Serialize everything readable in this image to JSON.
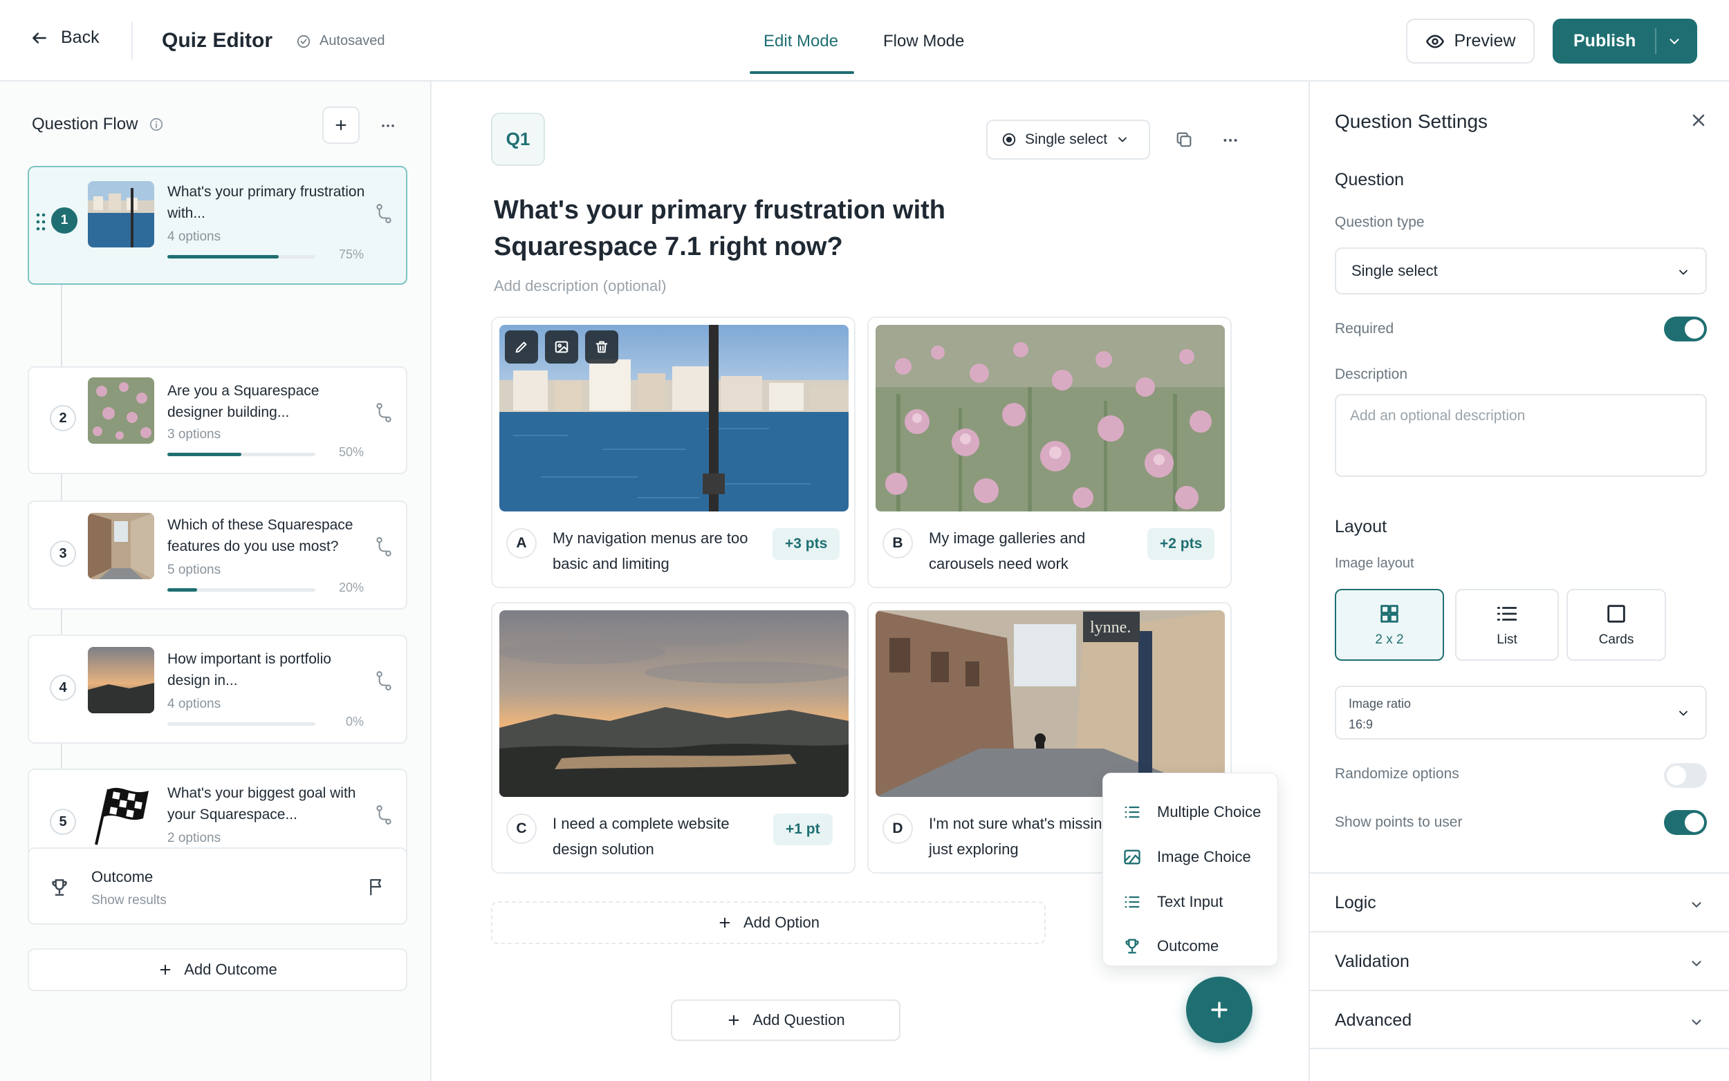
{
  "header": {
    "back_label": "Back",
    "title": "Quiz Editor",
    "autosave": "Autosaved",
    "tabs": [
      {
        "label": "Edit Mode",
        "active": true
      },
      {
        "label": "Flow Mode",
        "active": false
      }
    ],
    "preview_label": "Preview",
    "publish_label": "Publish"
  },
  "flow": {
    "title": "Question Flow",
    "questions": [
      {
        "num": "1",
        "text": "What's your primary frustration with...",
        "options": "4 options",
        "progress": 0.75,
        "pct": "75%",
        "active": true
      },
      {
        "num": "2",
        "text": "Are you a Squarespace designer building...",
        "options": "3 options",
        "progress": 0.5,
        "pct": "50%"
      },
      {
        "num": "3",
        "text": "Which of these Squarespace features do you use most?",
        "options": "5 options",
        "progress": 0.2,
        "pct": "20%"
      },
      {
        "num": "4",
        "text": "How important is portfolio design in...",
        "options": "4 options",
        "progress": 0,
        "pct": "0%"
      },
      {
        "num": "5",
        "text": "What's your biggest goal with your Squarespace...",
        "options": "2 options",
        "progress": 0,
        "pct": "0%"
      }
    ],
    "outcome": {
      "title": "Outcome",
      "subtitle": "Show results"
    },
    "add_outcome_label": "Add Outcome"
  },
  "editor": {
    "badge": "Q1",
    "type_select": "Single select",
    "question_title": "What's your primary frustration with Squarespace 7.1 right now?",
    "description_placeholder": "Add description (optional)",
    "options": [
      {
        "letter": "A",
        "text": "My navigation menus are too basic and limiting",
        "points": "+3 pts"
      },
      {
        "letter": "B",
        "text": "My image galleries and carousels need work",
        "points": "+2 pts"
      },
      {
        "letter": "C",
        "text": "I need a complete website design solution",
        "points": "+1 pt"
      },
      {
        "letter": "D",
        "text": "I'm not sure what's missing yet, just exploring",
        "points": ""
      }
    ],
    "storefront_sign": "lynne.",
    "add_option_label": "Add Option",
    "add_question_label": "Add Question",
    "menu_items": [
      "Multiple Choice",
      "Image Choice",
      "Text Input",
      "Outcome"
    ]
  },
  "settings": {
    "title": "Question Settings",
    "question_heading": "Question",
    "question_type_label": "Question type",
    "question_type_value": "Single select",
    "required_label": "Required",
    "required": true,
    "description_label": "Description",
    "description_placeholder": "Add an optional description",
    "layout_heading": "Layout",
    "image_layout_label": "Image layout",
    "layouts": [
      {
        "label": "2 x 2",
        "selected": true
      },
      {
        "label": "List",
        "selected": false
      },
      {
        "label": "Cards",
        "selected": false
      }
    ],
    "image_ratio_label": "Image ratio",
    "image_ratio_value": "16:9",
    "randomize_label": "Randomize options",
    "randomize": false,
    "show_points_label": "Show points to user",
    "show_points": true,
    "accordions": [
      "Logic",
      "Validation",
      "Advanced"
    ]
  },
  "colors": {
    "accent": "#1f6f72",
    "accent_light": "#eef8f8",
    "border": "#e6eaee"
  }
}
